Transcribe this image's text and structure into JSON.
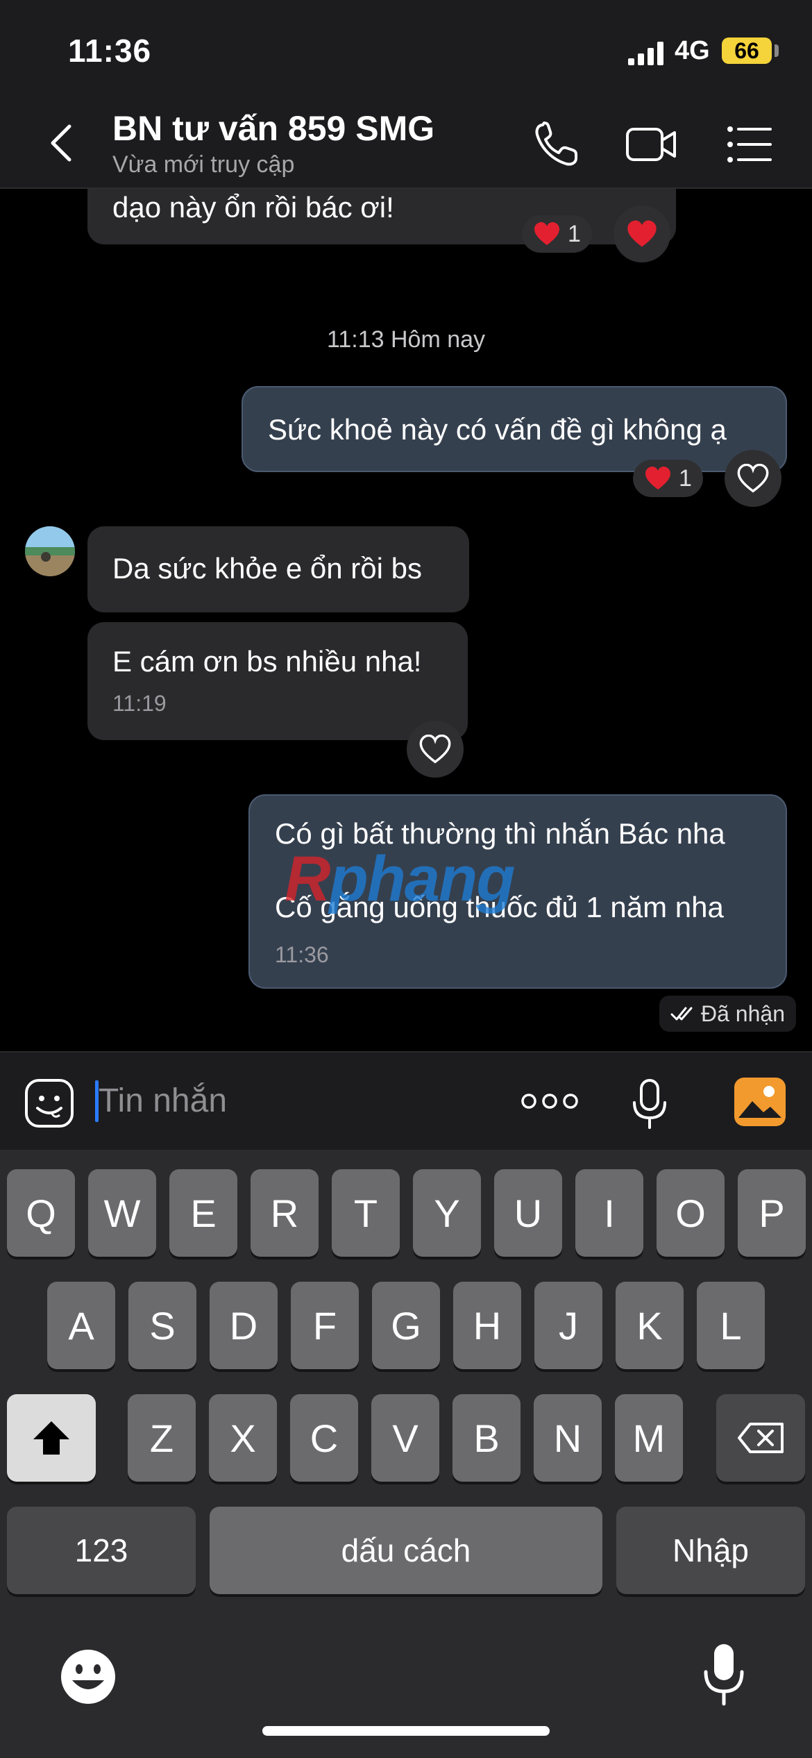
{
  "status_bar": {
    "time": "11:36",
    "network": "4G",
    "battery": "66"
  },
  "header": {
    "title": "BN tư vấn 859 SMG",
    "subtitle": "Vừa mới truy cập",
    "icons": [
      "back-chevron-icon",
      "phone-icon",
      "video-call-icon",
      "menu-list-icon"
    ]
  },
  "chat": {
    "messages": [
      {
        "direction": "incoming",
        "text": "dạo này ổn rồi bác ơi!",
        "reaction": "❤️",
        "reaction_count": "1",
        "liked": true
      },
      {
        "direction": "outgoing",
        "text": "Sức khoẻ này có vấn đề gì không ạ",
        "reaction": "❤️",
        "reaction_count": "1",
        "liked": false
      },
      {
        "direction": "incoming",
        "text": "Da sức khỏe e ổn rồi bs"
      },
      {
        "direction": "incoming",
        "text": "E cám ơn bs nhiều nha!",
        "time": "11:19",
        "liked": false
      },
      {
        "direction": "outgoing",
        "lines": [
          "Có gì bất thường thì nhắn Bác nha",
          "Cố gắng uống thuốc đủ 1 năm nha"
        ],
        "time": "11:36"
      }
    ],
    "day_separator": "11:13 Hôm nay",
    "status": "Đã nhận",
    "watermark": {
      "prefix": "R",
      "rest": "phang"
    }
  },
  "input": {
    "placeholder": "Tin nhắn",
    "icons": [
      "sticker-icon",
      "more-options-icon",
      "microphone-icon",
      "image-icon"
    ]
  },
  "keyboard": {
    "row1": [
      "Q",
      "W",
      "E",
      "R",
      "T",
      "Y",
      "U",
      "I",
      "O",
      "P"
    ],
    "row2": [
      "A",
      "S",
      "D",
      "F",
      "G",
      "H",
      "J",
      "K",
      "L"
    ],
    "row3": [
      "Z",
      "X",
      "C",
      "V",
      "B",
      "N",
      "M"
    ],
    "numbers_label": "123",
    "space_label": "dấu cách",
    "return_label": "Nhập",
    "icons": [
      "shift-icon",
      "backspace-icon",
      "emoji-icon",
      "dictation-mic-icon"
    ]
  },
  "colors": {
    "bubble_out": "#35404f",
    "bubble_in": "#2a2a2c",
    "battery": "#f4d33b",
    "image_button": "#f29a2e",
    "cursor": "#2b7bff"
  }
}
